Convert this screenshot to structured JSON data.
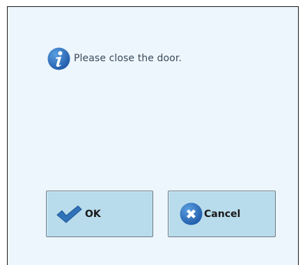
{
  "dialog": {
    "message": "Please close the door.",
    "message_icon": "info-icon"
  },
  "buttons": {
    "ok_label": "OK",
    "ok_icon": "checkmark-icon",
    "cancel_label": "Cancel",
    "cancel_icon": "close-circle-icon"
  },
  "colors": {
    "background": "#edf6fc",
    "button_face": "#b9dcec",
    "accent_blue": "#2f6fb0"
  }
}
